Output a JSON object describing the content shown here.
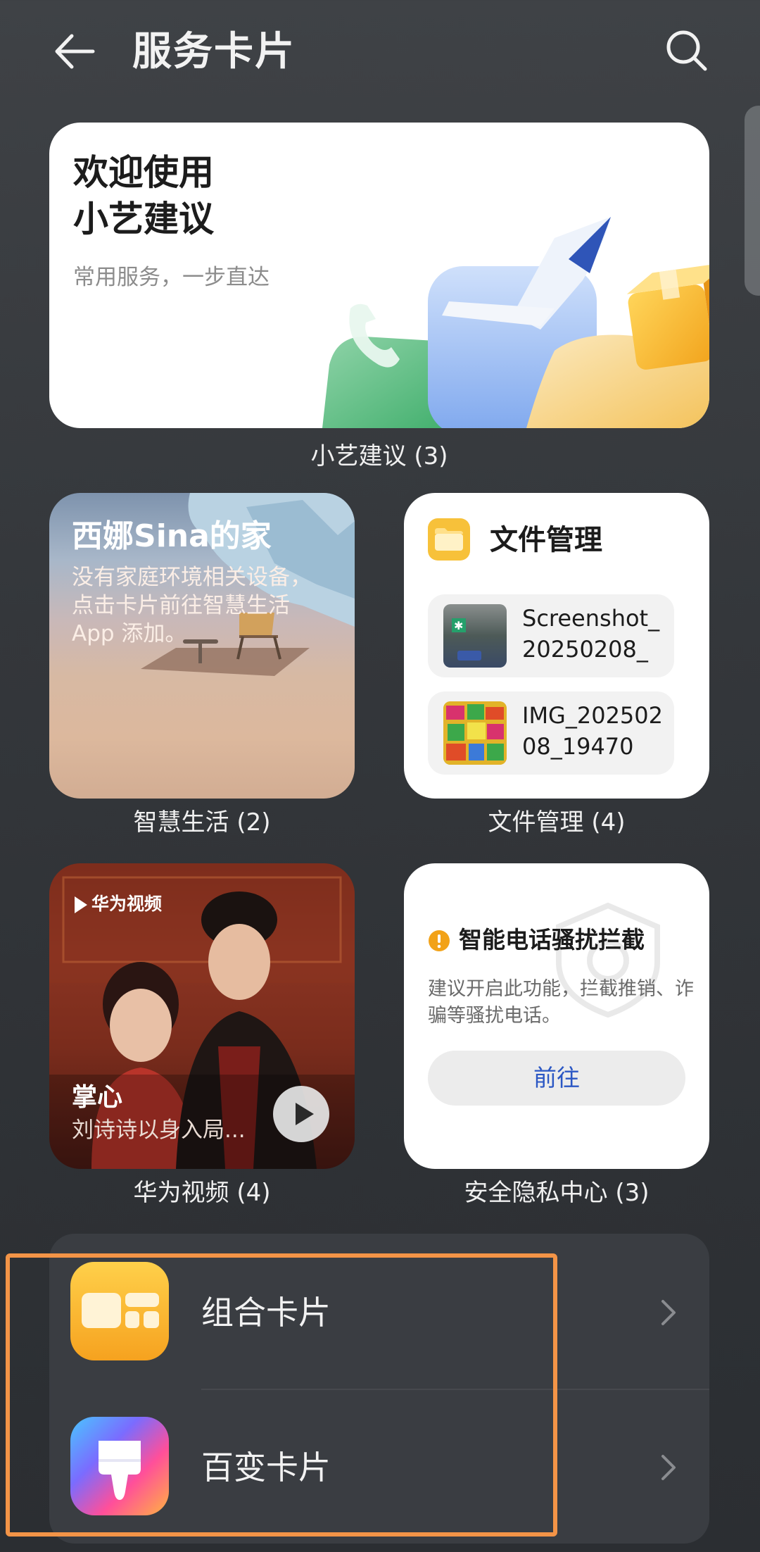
{
  "header": {
    "title": "服务卡片"
  },
  "cards": [
    {
      "title_line1": "欢迎使用",
      "title_line2": "小艺建议",
      "subtitle": "常用服务，一步直达",
      "caption": "小艺建议 (3)"
    },
    {
      "title": "西娜Sina的家",
      "description": "没有家庭环境相关设备，点击卡片前往智慧生活 App 添加。",
      "caption": "智慧生活 (2)"
    },
    {
      "title": "文件管理",
      "files": [
        "Screenshot_20250208_2...",
        "IMG_20250208_194703..."
      ],
      "caption": "文件管理 (4)"
    },
    {
      "logo": "华为视频",
      "show_name": "掌心",
      "show_desc": "刘诗诗以身入局...",
      "caption": "华为视频 (4)"
    },
    {
      "title": "智能电话骚扰拦截",
      "description": "建议开启此功能，拦截推销、诈骗等骚扰电话。",
      "button": "前往",
      "caption": "安全隐私中心 (3)"
    }
  ],
  "list": [
    {
      "label": "组合卡片",
      "icon": "combo-card-icon"
    },
    {
      "label": "百变卡片",
      "icon": "brush-icon"
    }
  ],
  "colors": {
    "highlight": "#f39447",
    "link": "#2b57c4",
    "accent_orange": "#f5b83a"
  }
}
